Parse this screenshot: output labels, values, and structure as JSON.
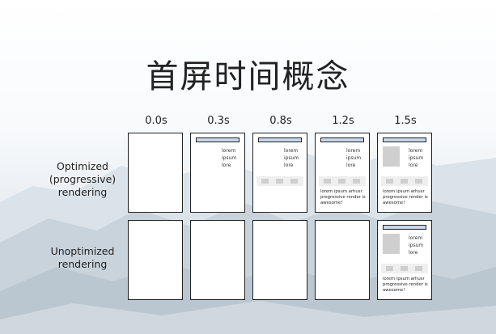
{
  "title": "首屏时间概念",
  "time_labels": [
    "0.0s",
    "0.3s",
    "0.8s",
    "1.2s",
    "1.5s"
  ],
  "rows": [
    {
      "label_lines": [
        "Optimized",
        "(progressive)",
        "rendering"
      ]
    },
    {
      "label_lines": [
        "Unoptimized",
        "rendering"
      ]
    }
  ],
  "frame_text": {
    "lines": [
      "lorem",
      "ipsum",
      "lore"
    ],
    "paragraph": "lorem ipsum arhusr progressive render is awesome!"
  },
  "colors": {
    "header_bar": "#c6d7ea",
    "placeholder_gray": "#cfcfcf",
    "frame_border": "#222222"
  }
}
